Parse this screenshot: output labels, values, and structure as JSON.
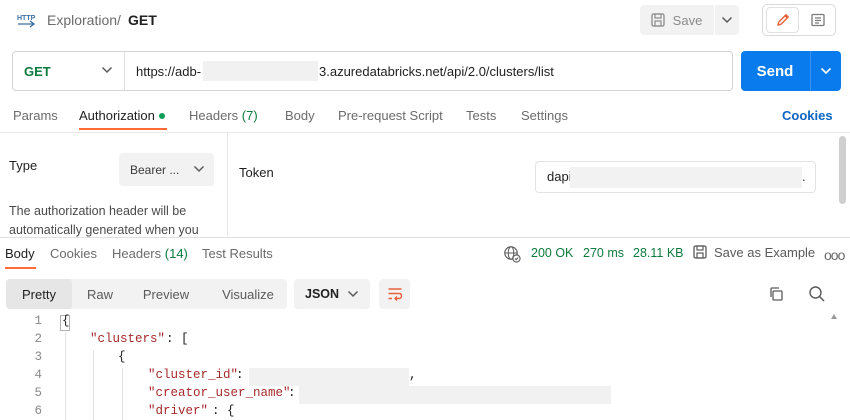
{
  "header": {
    "breadcrumb_parent": "Exploration",
    "breadcrumb_sep": "/",
    "breadcrumb_current": "GET",
    "save_label": "Save"
  },
  "request": {
    "method": "GET",
    "url_prefix": "https://adb-",
    "url_suffix": "3.azuredatabricks.net/api/2.0/clusters/list",
    "send_label": "Send"
  },
  "request_tabs": {
    "params": "Params",
    "authorization": "Authorization",
    "headers": "Headers",
    "headers_count": "(7)",
    "body": "Body",
    "prerequest": "Pre-request Script",
    "tests": "Tests",
    "settings": "Settings",
    "cookies": "Cookies"
  },
  "auth": {
    "type_label": "Type",
    "type_value": "Bearer ...",
    "description_line1": "The authorization header will be",
    "description_line2": "automatically generated when you",
    "token_label": "Token",
    "token_value_prefix": "dapi",
    "token_value_suffix": "."
  },
  "response_tabs": {
    "body": "Body",
    "cookies": "Cookies",
    "headers": "Headers",
    "headers_count": "(14)",
    "test_results": "Test Results"
  },
  "response_status": {
    "status": "200 OK",
    "time": "270 ms",
    "size": "28.11 KB",
    "save_example": "Save as Example",
    "more": "ooo"
  },
  "view": {
    "pretty": "Pretty",
    "raw": "Raw",
    "preview": "Preview",
    "visualize": "Visualize",
    "format": "JSON"
  },
  "code": {
    "lines": [
      {
        "n": "1",
        "text": "{"
      },
      {
        "n": "2",
        "key": "\"clusters\"",
        "rest": ": ["
      },
      {
        "n": "3",
        "text": "{"
      },
      {
        "n": "4",
        "key": "\"cluster_id\"",
        "rest": ":",
        "tail": ","
      },
      {
        "n": "5",
        "key": "\"creator_user_name\"",
        "rest": ":"
      },
      {
        "n": "6",
        "key": "\"driver\"",
        "rest": ": {"
      }
    ]
  },
  "colors": {
    "accent": "#ff6c37",
    "send": "#097bed",
    "method": "#0c7b3d",
    "status": "#0c7b3d",
    "json_key": "#a52a2a"
  },
  "icons": {
    "http": "http-icon",
    "save": "save-icon",
    "edit": "pencil-icon",
    "doc": "doc-icon",
    "globe": "globe-icon",
    "wrap": "wrap-lines-icon",
    "copy": "copy-icon",
    "search": "search-icon"
  }
}
